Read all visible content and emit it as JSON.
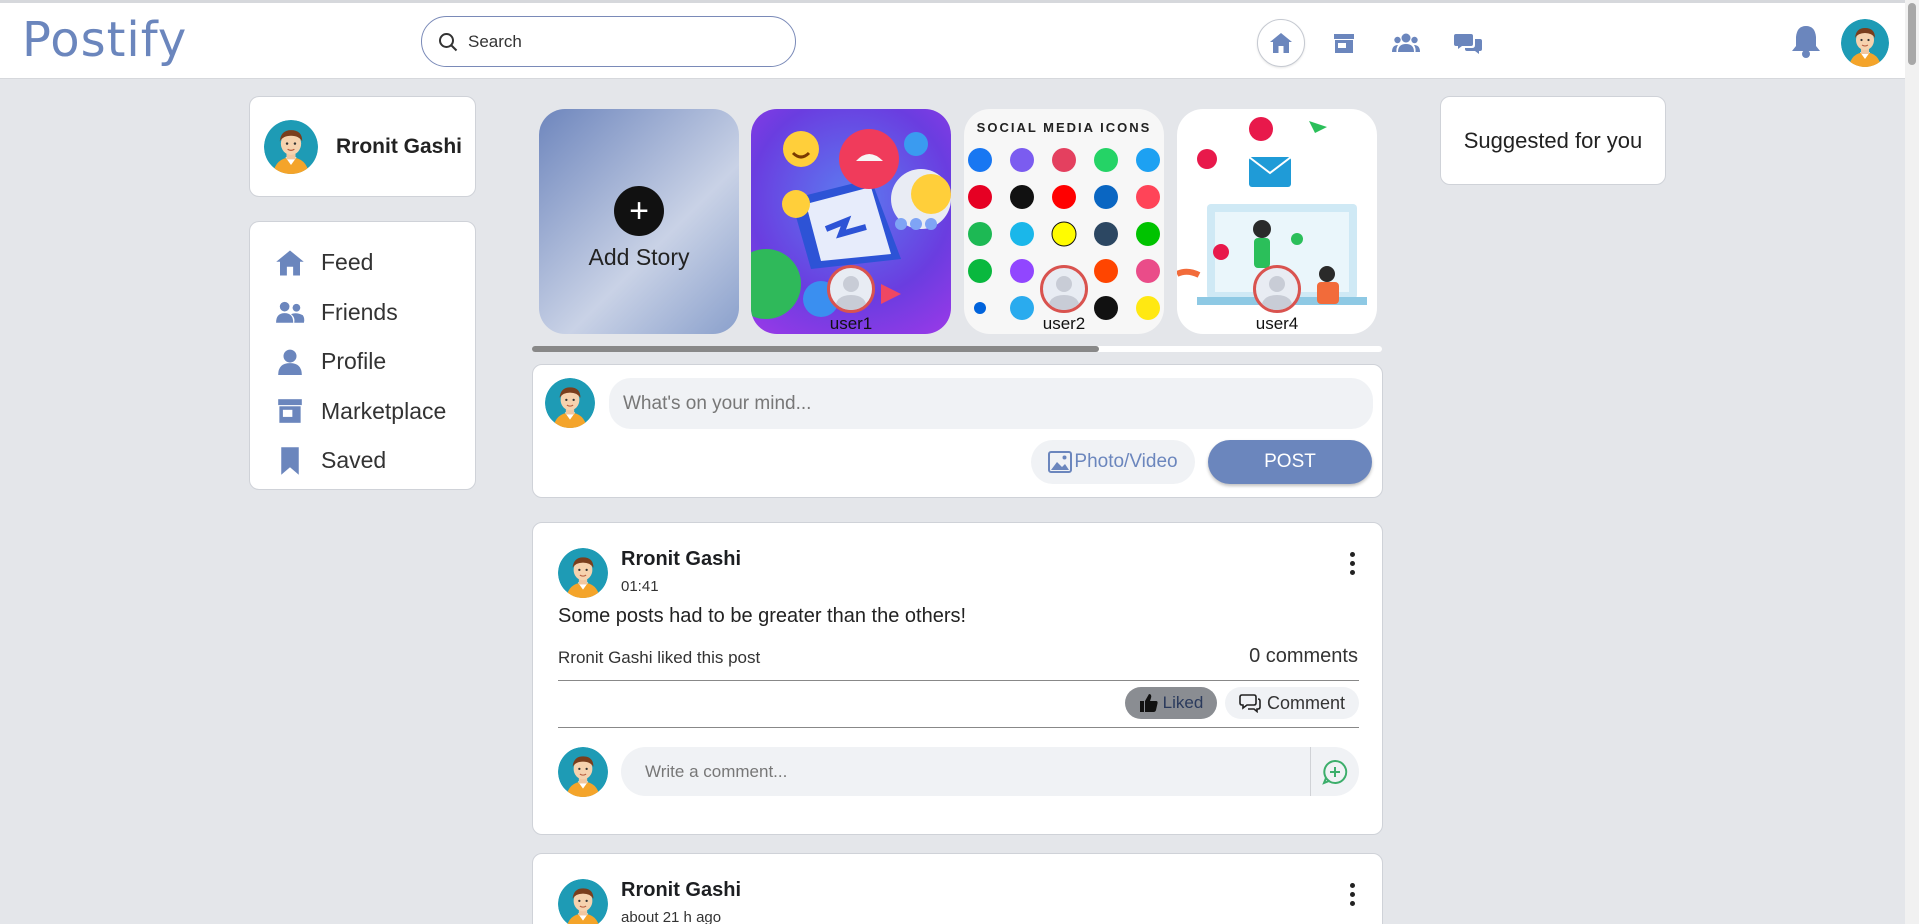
{
  "app": {
    "logo": "Postify"
  },
  "search": {
    "placeholder": "Search"
  },
  "topnav": {
    "icons": [
      "home-icon",
      "marketplace-icon",
      "friends-icon",
      "chat-icon"
    ],
    "active": "home-icon",
    "right_icons": [
      "bell-icon",
      "avatar"
    ]
  },
  "user": {
    "name": "Rronit Gashi"
  },
  "sidebar": {
    "items": [
      {
        "label": "Feed",
        "icon": "home-icon"
      },
      {
        "label": "Friends",
        "icon": "friends-icon"
      },
      {
        "label": "Profile",
        "icon": "person-icon"
      },
      {
        "label": "Marketplace",
        "icon": "store-icon"
      },
      {
        "label": "Saved",
        "icon": "bookmark-icon"
      }
    ]
  },
  "stories": {
    "add_label": "Add Story",
    "items": [
      {
        "user": "user1"
      },
      {
        "user": "user2",
        "banner": "SOCIAL MEDIA ICONS"
      },
      {
        "user": "user4"
      }
    ]
  },
  "composer": {
    "placeholder": "What's on your mind...",
    "photo_label": "Photo/Video",
    "post_label": "POST"
  },
  "posts": [
    {
      "author": "Rronit Gashi",
      "time": "01:41",
      "text": "Some posts had to be greater than the others!",
      "likes_text": "Rronit Gashi liked this post",
      "comments_count": "0 comments",
      "liked_label": "Liked",
      "comment_label": "Comment",
      "comment_placeholder": "Write a comment..."
    },
    {
      "author": "Rronit Gashi",
      "time": "about 21 h ago"
    }
  ],
  "suggested": {
    "title": "Suggested for you"
  },
  "colors": {
    "accent": "#6b86bd",
    "background": "#e4e6ea",
    "surface": "#ffffff"
  }
}
